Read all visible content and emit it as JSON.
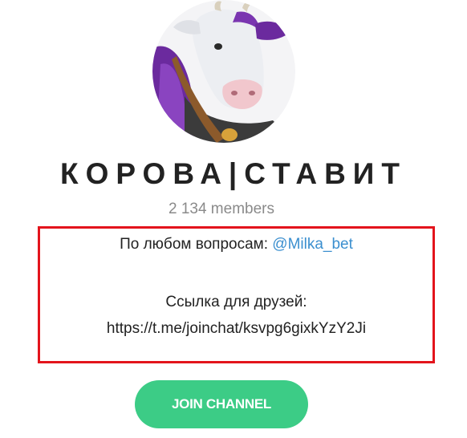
{
  "channel": {
    "title": "КОРОВА|СТАВИТ",
    "members": "2 134 members"
  },
  "description": {
    "line1_prefix": "По любом вопросам: ",
    "line1_mention": "@Milka_bet",
    "line2": "Ссылка для друзей:",
    "line3": "https://t.me/joinchat/ksvpg6gixkYzY2Ji"
  },
  "join_button": {
    "label": "JOIN CHANNEL"
  },
  "colors": {
    "accent_green": "#3ccc86",
    "link_blue": "#3b8fcf",
    "highlight_red": "#e3141c",
    "cow_purple": "#6b2a9e"
  },
  "icons": {
    "avatar": "milka-cow-avatar"
  }
}
